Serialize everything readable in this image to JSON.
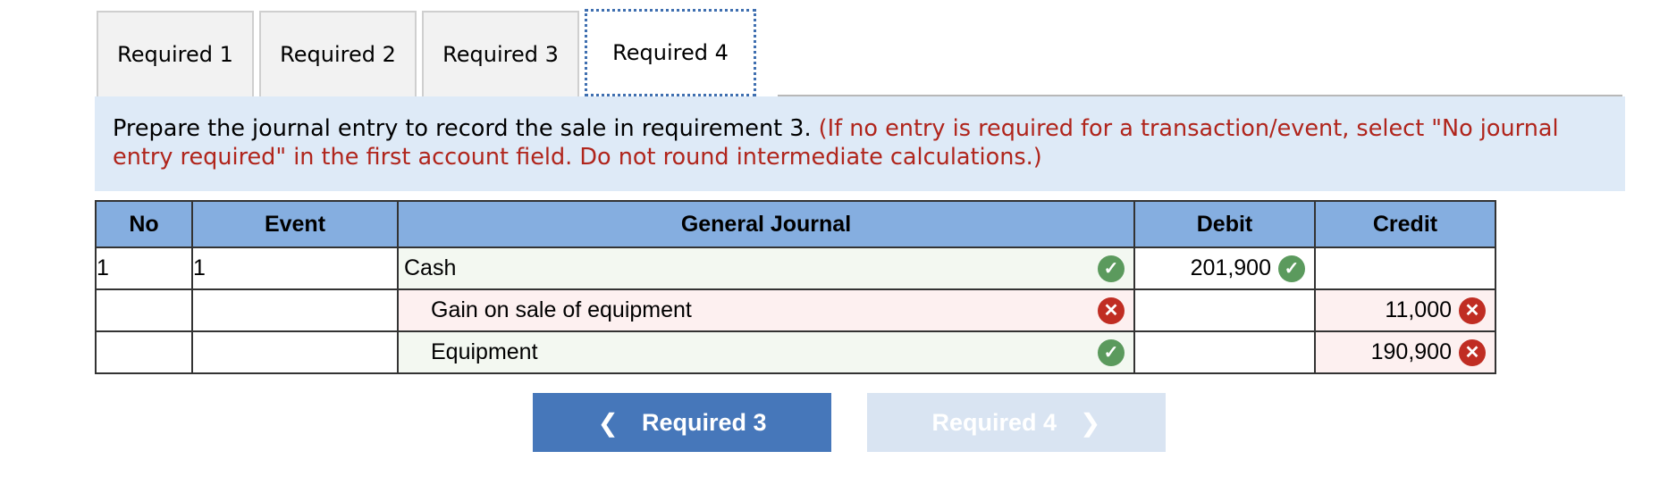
{
  "tabs": [
    {
      "label": "Required 1",
      "active": false
    },
    {
      "label": "Required 2",
      "active": false
    },
    {
      "label": "Required 3",
      "active": false
    },
    {
      "label": "Required 4",
      "active": true
    }
  ],
  "instructions": {
    "main": "Prepare the journal entry to record the sale in requirement 3.",
    "note": "(If no entry is required for a transaction/event, select \"No journal entry required\" in the first account field. Do not round intermediate calculations.)"
  },
  "table": {
    "headers": [
      "No",
      "Event",
      "General Journal",
      "Debit",
      "Credit"
    ],
    "rows": [
      {
        "no": "1",
        "event": "1",
        "account": "Cash",
        "account_status": "correct",
        "debit": "201,900",
        "debit_status": "correct",
        "credit": "",
        "credit_status": ""
      },
      {
        "no": "",
        "event": "",
        "account": "Gain on sale of equipment",
        "account_status": "incorrect",
        "debit": "",
        "debit_status": "",
        "credit": "11,000",
        "credit_status": "incorrect"
      },
      {
        "no": "",
        "event": "",
        "account": "Equipment",
        "account_status": "correct",
        "debit": "",
        "debit_status": "",
        "credit": "190,900",
        "credit_status": "incorrect"
      }
    ]
  },
  "nav": {
    "prev_label": "Required 3",
    "next_label": "Required 4",
    "prev_icon": "chevron-left-icon",
    "next_icon": "chevron-right-icon"
  },
  "colors": {
    "header_bg": "#85aee0",
    "panel_bg": "#deeaf7",
    "note_red": "#b0251c",
    "correct": "#5b9a5d",
    "incorrect": "#c02d23",
    "button_primary": "#4677ba",
    "button_disabled": "#d9e4f2"
  }
}
